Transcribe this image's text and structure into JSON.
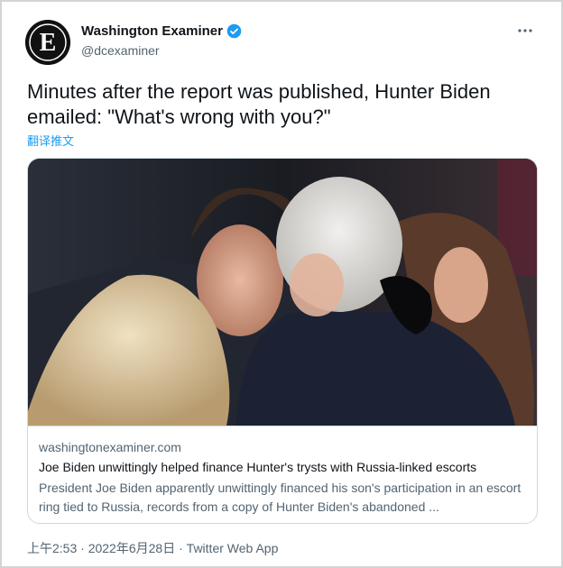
{
  "author": {
    "display_name": "Washington Examiner",
    "handle": "@dcexaminer",
    "avatar_letter": "E",
    "verified_icon": "verified-badge-icon",
    "verified_color": "#1d9bf0"
  },
  "menu": {
    "icon": "more-dots-icon"
  },
  "tweet": {
    "text": "Minutes after the report was published, Hunter Biden emailed: \"What's wrong with you?\"",
    "translate_label": "翻译推文"
  },
  "card": {
    "domain": "washingtonexaminer.com",
    "title": "Joe Biden unwittingly helped finance Hunter's trysts with Russia-linked escorts",
    "description": "President Joe Biden apparently unwittingly financed his son's participation in an escort ring tied to Russia, records from a copy of Hunter Biden's abandoned ..."
  },
  "meta": {
    "time": "上午2:53",
    "separator": "·",
    "date": "2022年6月28日",
    "app": "Twitter Web App"
  },
  "colors": {
    "accent": "#1d9bf0",
    "text_primary": "#0f1419",
    "text_secondary": "#536471",
    "border": "#cfd9de"
  }
}
